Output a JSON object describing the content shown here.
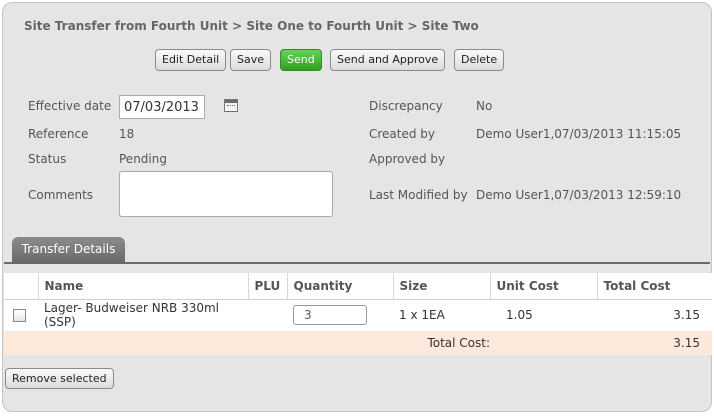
{
  "header": {
    "title": "Site Transfer from Fourth Unit > Site One to Fourth Unit > Site Two"
  },
  "toolbar": {
    "edit_label": "Edit Detail",
    "save_label": "Save",
    "send_label": "Send",
    "send_approve_label": "Send and Approve",
    "delete_label": "Delete"
  },
  "form": {
    "effective_date_label": "Effective date",
    "effective_date_value": "07/03/2013",
    "reference_label": "Reference",
    "reference_value": "18",
    "status_label": "Status",
    "status_value": "Pending",
    "comments_label": "Comments",
    "comments_value": "",
    "discrepancy_label": "Discrepancy",
    "discrepancy_value": "No",
    "created_by_label": "Created by",
    "created_by_value": "Demo User1,07/03/2013 11:15:05",
    "approved_by_label": "Approved by",
    "approved_by_value": "",
    "last_modified_label": "Last Modified by",
    "last_modified_value": "Demo User1,07/03/2013 12:59:10"
  },
  "tabs": [
    {
      "label": "Transfer Details"
    }
  ],
  "table": {
    "columns": [
      "",
      "Name",
      "PLU",
      "Quantity",
      "Size",
      "Unit Cost",
      "Total Cost"
    ],
    "rows": [
      {
        "name": "Lager- Budweiser NRB 330ml (SSP)",
        "plu": "",
        "quantity": "3",
        "size": "1 x 1EA",
        "unit_cost": "1.05",
        "total_cost": "3.15"
      }
    ],
    "total_label": "Total Cost:",
    "total_value": "3.15"
  },
  "footer": {
    "remove_label": "Remove selected"
  },
  "icons": {
    "calendar": "calendar-icon"
  },
  "colors": {
    "send_button": "#3fb332",
    "total_row": "#fde8dc",
    "tab": "#7a7a7a"
  }
}
